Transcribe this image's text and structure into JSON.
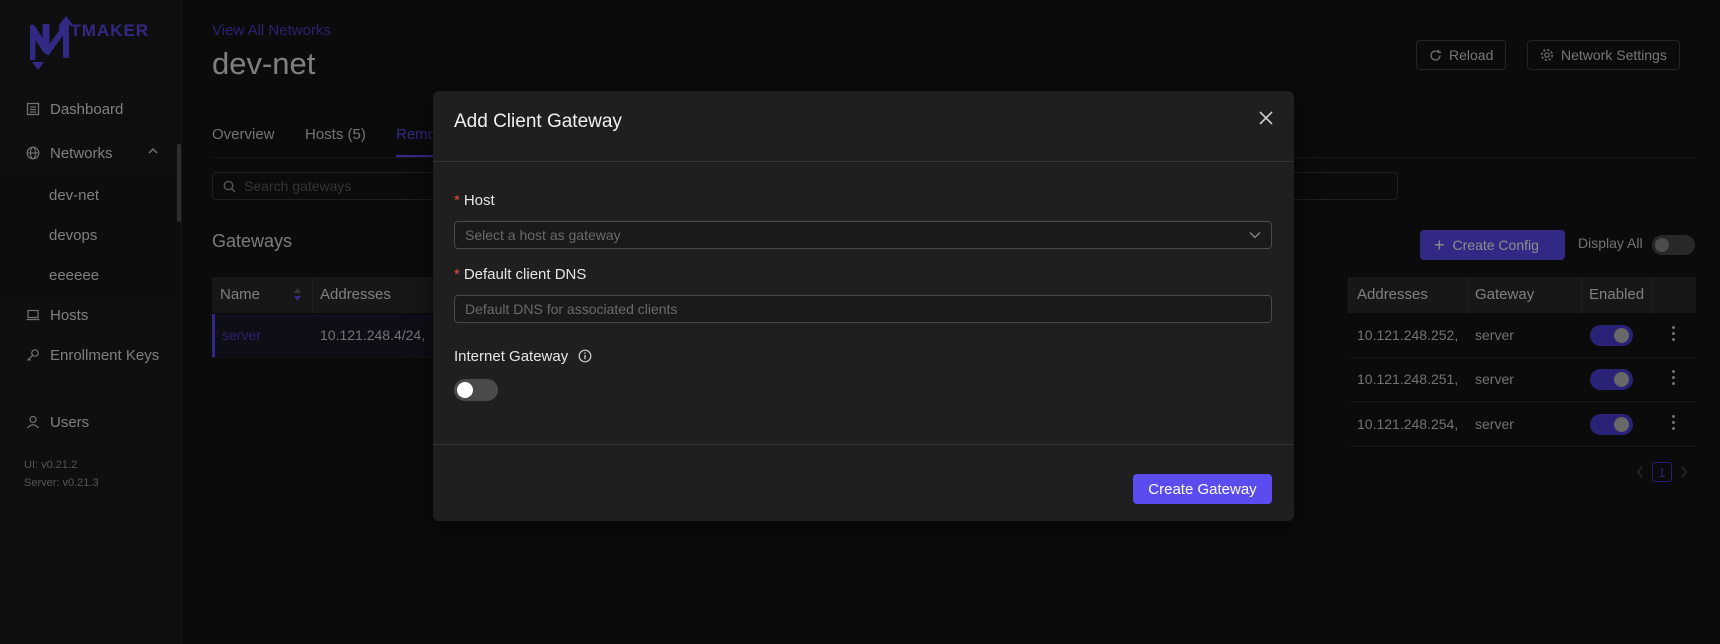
{
  "app": {
    "logo_text": "ETMAKER"
  },
  "sidebar": {
    "dashboard": "Dashboard",
    "networks": "Networks",
    "subitems": [
      "dev-net",
      "devops",
      "eeeeee"
    ],
    "hosts": "Hosts",
    "enrollment_keys": "Enrollment Keys",
    "users": "Users",
    "ui_version": "UI: v0.21.2",
    "server_version": "Server: v0.21.3"
  },
  "header": {
    "view_all": "View All Networks",
    "title": "dev-net",
    "reload": "Reload",
    "network_settings": "Network Settings"
  },
  "tabs": [
    {
      "label": "Overview"
    },
    {
      "label": "Hosts (5)"
    },
    {
      "label": "Remo"
    }
  ],
  "search": {
    "placeholder": "Search gateways"
  },
  "gateways": {
    "title": "Gateways",
    "create_config": "Create Config",
    "display_all": "Display All",
    "left_table": {
      "headers": {
        "name": "Name",
        "addresses": "Addresses"
      },
      "rows": [
        {
          "name": "server",
          "addresses": "10.121.248.4/24,"
        }
      ]
    },
    "right_table": {
      "headers": {
        "addresses": "Addresses",
        "gateway": "Gateway",
        "enabled": "Enabled"
      },
      "rows": [
        {
          "addresses": "10.121.248.252,",
          "gateway": "server",
          "enabled": true
        },
        {
          "addresses": "10.121.248.251,",
          "gateway": "server",
          "enabled": true
        },
        {
          "addresses": "10.121.248.254,",
          "gateway": "server",
          "enabled": true
        }
      ]
    },
    "pagination": {
      "current": "1"
    }
  },
  "modal": {
    "title": "Add Client Gateway",
    "host_label": "Host",
    "host_placeholder": "Select a host as gateway",
    "dns_label": "Default client DNS",
    "dns_placeholder": "Default DNS for associated clients",
    "internet_gateway_label": "Internet Gateway",
    "internet_gateway_enabled": false,
    "submit": "Create Gateway"
  },
  "colors": {
    "accent": "#5b4cf0",
    "background": "#141414",
    "modal": "#1f1f1f"
  }
}
